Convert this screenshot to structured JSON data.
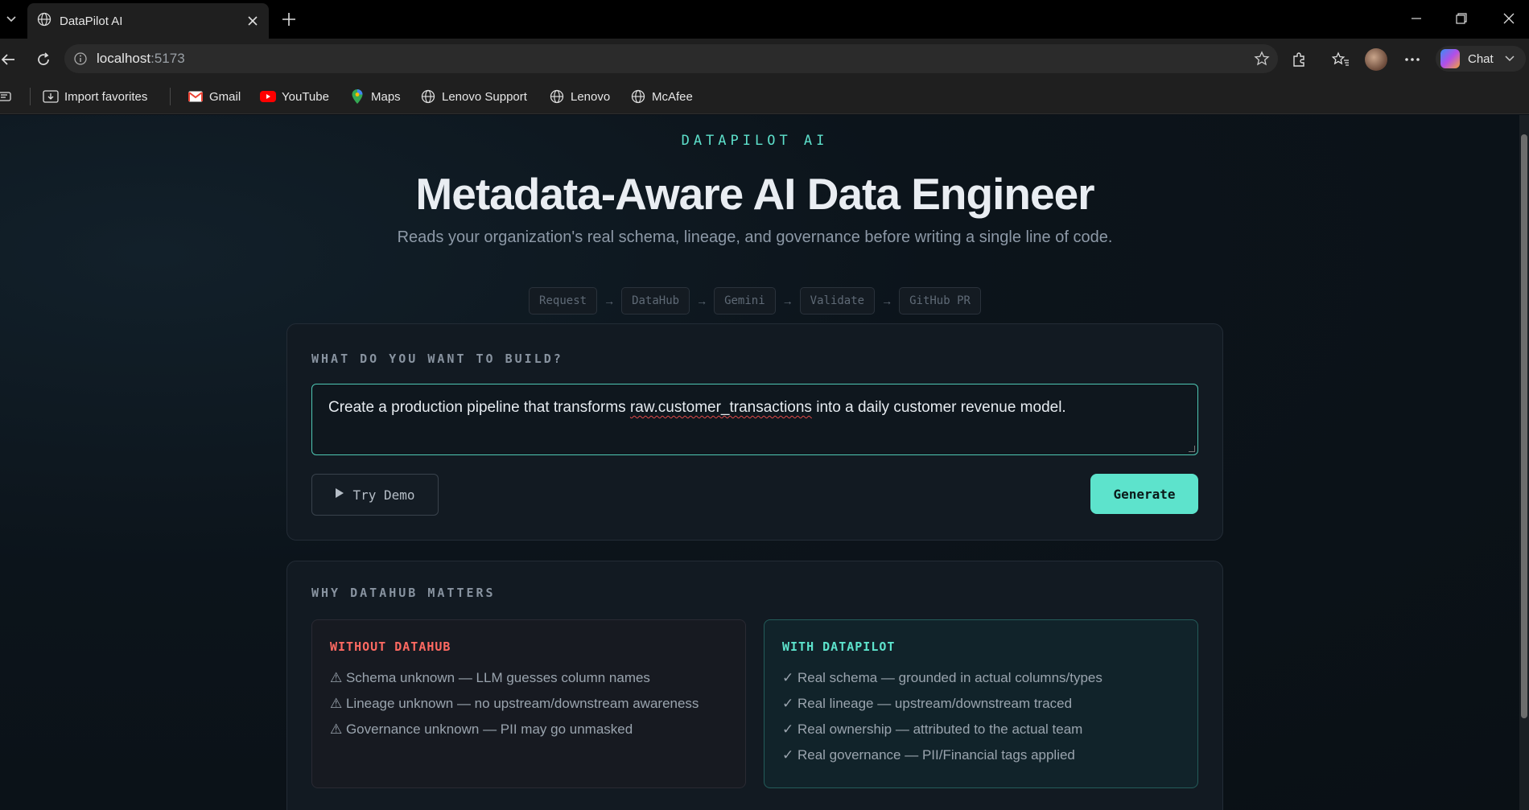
{
  "browser": {
    "tab_title": "DataPilot AI",
    "url_host": "localhost",
    "url_port": ":5173",
    "chat_label": "Chat",
    "bookmarks": [
      "Import favorites",
      "Gmail",
      "YouTube",
      "Maps",
      "Lenovo Support",
      "Lenovo",
      "McAfee"
    ]
  },
  "hero": {
    "brand": "DATAPILOT AI",
    "headline": "Metadata-Aware AI Data Engineer",
    "subhead": "Reads your organization's real schema, lineage, and governance before writing a single line of code.",
    "steps": [
      "Request",
      "DataHub",
      "Gemini",
      "Validate",
      "GitHub PR"
    ],
    "step_arrow": "→"
  },
  "build": {
    "label": "WHAT DO YOU WANT TO BUILD?",
    "prompt_before": "Create a production pipeline that transforms ",
    "prompt_flagged": "raw.customer_transactions",
    "prompt_after": " into a daily customer revenue model.",
    "demo_label": "Try Demo",
    "generate_label": "Generate"
  },
  "why": {
    "label": "WHY DATAHUB MATTERS",
    "without": {
      "title": "WITHOUT DATAHUB",
      "items": [
        "⚠ Schema unknown — LLM guesses column names",
        "⚠ Lineage unknown — no upstream/downstream awareness",
        "⚠ Governance unknown — PII may go unmasked"
      ]
    },
    "with": {
      "title": "WITH DATAPILOT",
      "items": [
        "✓ Real schema — grounded in actual columns/types",
        "✓ Real lineage — upstream/downstream traced",
        "✓ Real ownership — attributed to the actual team",
        "✓ Real governance — PII/Financial tags applied"
      ]
    }
  },
  "colors": {
    "accent": "#5de3cc",
    "warning": "#ff6a62",
    "page_bg": "#0b1016"
  }
}
